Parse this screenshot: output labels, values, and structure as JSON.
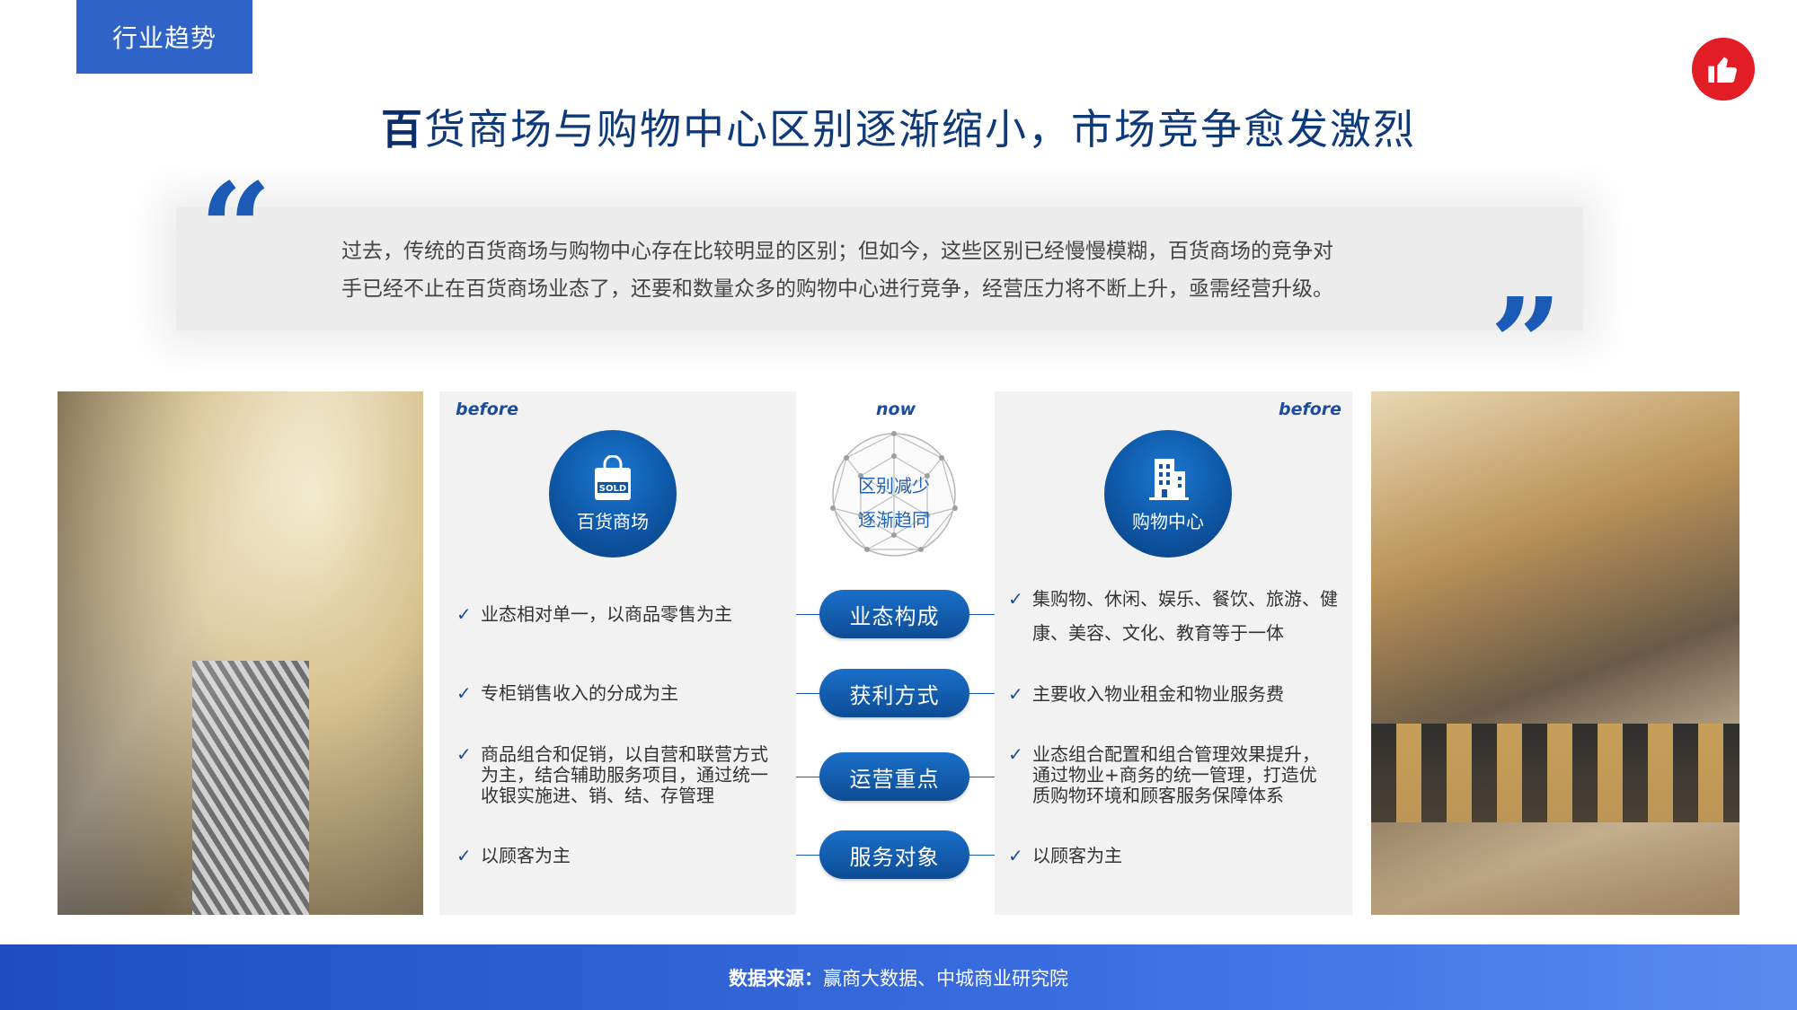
{
  "header": {
    "tag": "行业趋势"
  },
  "title": {
    "lead": "百",
    "rest": "货商场与购物中心区别逐渐缩小，市场竞争愈发激烈"
  },
  "quote": {
    "line1": "过去，传统的百货商场与购物中心存在比较明显的区别；但如今，这些区别已经慢慢模糊，百货商场的竞争对",
    "line2": "手已经不止在百货商场业态了，还要和数量众多的购物中心进行竞争，经营压力将不断上升，亟需经营升级。"
  },
  "left_panel": {
    "era": "before",
    "icon": "shopping-bag-icon",
    "circle_label": "百货商场",
    "items": [
      "业态相对单一，以商品零售为主",
      "专柜销售收入的分成为主",
      "商品组合和促销，以自营和联营方式为主，结合辅助服务项目，通过统一收银实施进、销、结、存管理",
      "以顾客为主"
    ]
  },
  "center": {
    "era": "now",
    "network_line1": "区别减少",
    "network_line2": "逐渐趋同",
    "pills": [
      "业态构成",
      "获利方式",
      "运营重点",
      "服务对象"
    ]
  },
  "right_panel": {
    "era": "before",
    "icon": "building-icon",
    "circle_label": "购物中心",
    "items": [
      "集购物、休闲、娱乐、餐饮、旅游、健康、美容、文化、教育等于一体",
      "主要收入物业租金和物业服务费",
      "业态组合配置和组合管理效果提升，通过物业+商务的统一管理，打造优质购物环境和顾客服务保障体系",
      "以顾客为主"
    ]
  },
  "footer": {
    "label": "数据来源：",
    "sources": "赢商大数据、中城商业研究院"
  },
  "colors": {
    "brand_blue": "#1c5bb5",
    "accent_red": "#e21d25",
    "panel_gray": "#f2f2f2"
  }
}
